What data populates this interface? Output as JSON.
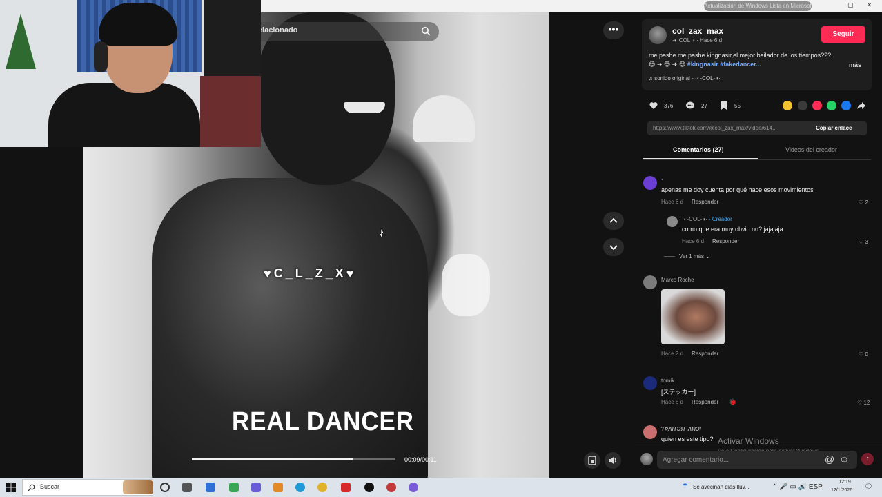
{
  "browser": {
    "update_notice": "Actualización de Windows Lista en Microsoft"
  },
  "video": {
    "search_placeholder": "Relacionado",
    "watermark": "♥C_L_Z_X♥",
    "caption": "REAL DANCER",
    "timecode": "00:09/00:11",
    "progress": 0.79
  },
  "post": {
    "author_name": "col_zax_max",
    "author_sub": "·◐ COL ◑ · Hace 6 d",
    "follow_label": "Seguir",
    "description": "me pashe me pashe kingnasir,el mejor bailador de los tiempos??? 😊 ➜ 😊 ➜ 😊",
    "hashtags": "#kingnasir #fakedancer...",
    "more_label": "más",
    "sound": "♫ sonido original - ·◐-COL-◑·",
    "likes": "376",
    "comments_count": "27",
    "saves": "55",
    "link": "https://www.tiktok.com/@col_zax_max/video/614...",
    "copy_link_label": "Copiar enlace"
  },
  "tabs": {
    "comments": "Comentarios (27)",
    "videos": "Videos del creador"
  },
  "comments": [
    {
      "user": "·",
      "text": "apenas me doy cuenta por qué hace esos movimientos",
      "time": "Hace 6 d",
      "reply": "Responder",
      "likes": "2",
      "avatar_color": "#6b3fd4"
    },
    {
      "user": "·◐-COL-◑·",
      "creator_tag": "· Creador",
      "text": "como que era muy obvio no? jajajaja",
      "time": "Hace 6 d",
      "reply": "Responder",
      "likes": "3",
      "avatar_color": "#8a8a8a"
    },
    {
      "view_more": "Ver 1 más ⌄"
    },
    {
      "user": "Marco Roche",
      "time": "Hace 2 d",
      "reply": "Responder",
      "likes": "0",
      "avatar_color": "#7b7b7b"
    },
    {
      "user": "tomik",
      "text": "[ステッカー]",
      "time": "Hace 6 d",
      "reply": "Responder",
      "likes": "12",
      "avatar_color": "#1c2a7a"
    },
    {
      "user": "ƬƦΛIƬƆЯ_ΛЯƆI",
      "text": "quien es este tipo?",
      "avatar_color": "#c96f6f"
    }
  ],
  "comment_bar": {
    "placeholder": "Agregar comentario...",
    "mention": "@",
    "emoji": "☺",
    "post": "↑"
  },
  "windows": {
    "activate_title": "Activar Windows",
    "activate_sub": "Ve a Configuración para activar Windows.",
    "search_text": "Buscar",
    "weather": "Se avecinan días lluv...",
    "tray": "⌃  🎤  ▭  🔊  ESP",
    "clock_time": "12:19",
    "clock_date": "12/1/2026"
  },
  "colors": {
    "follow": "#fe2c55",
    "hashtag": "#6fa8ff",
    "creator": "#3fa9f5"
  }
}
